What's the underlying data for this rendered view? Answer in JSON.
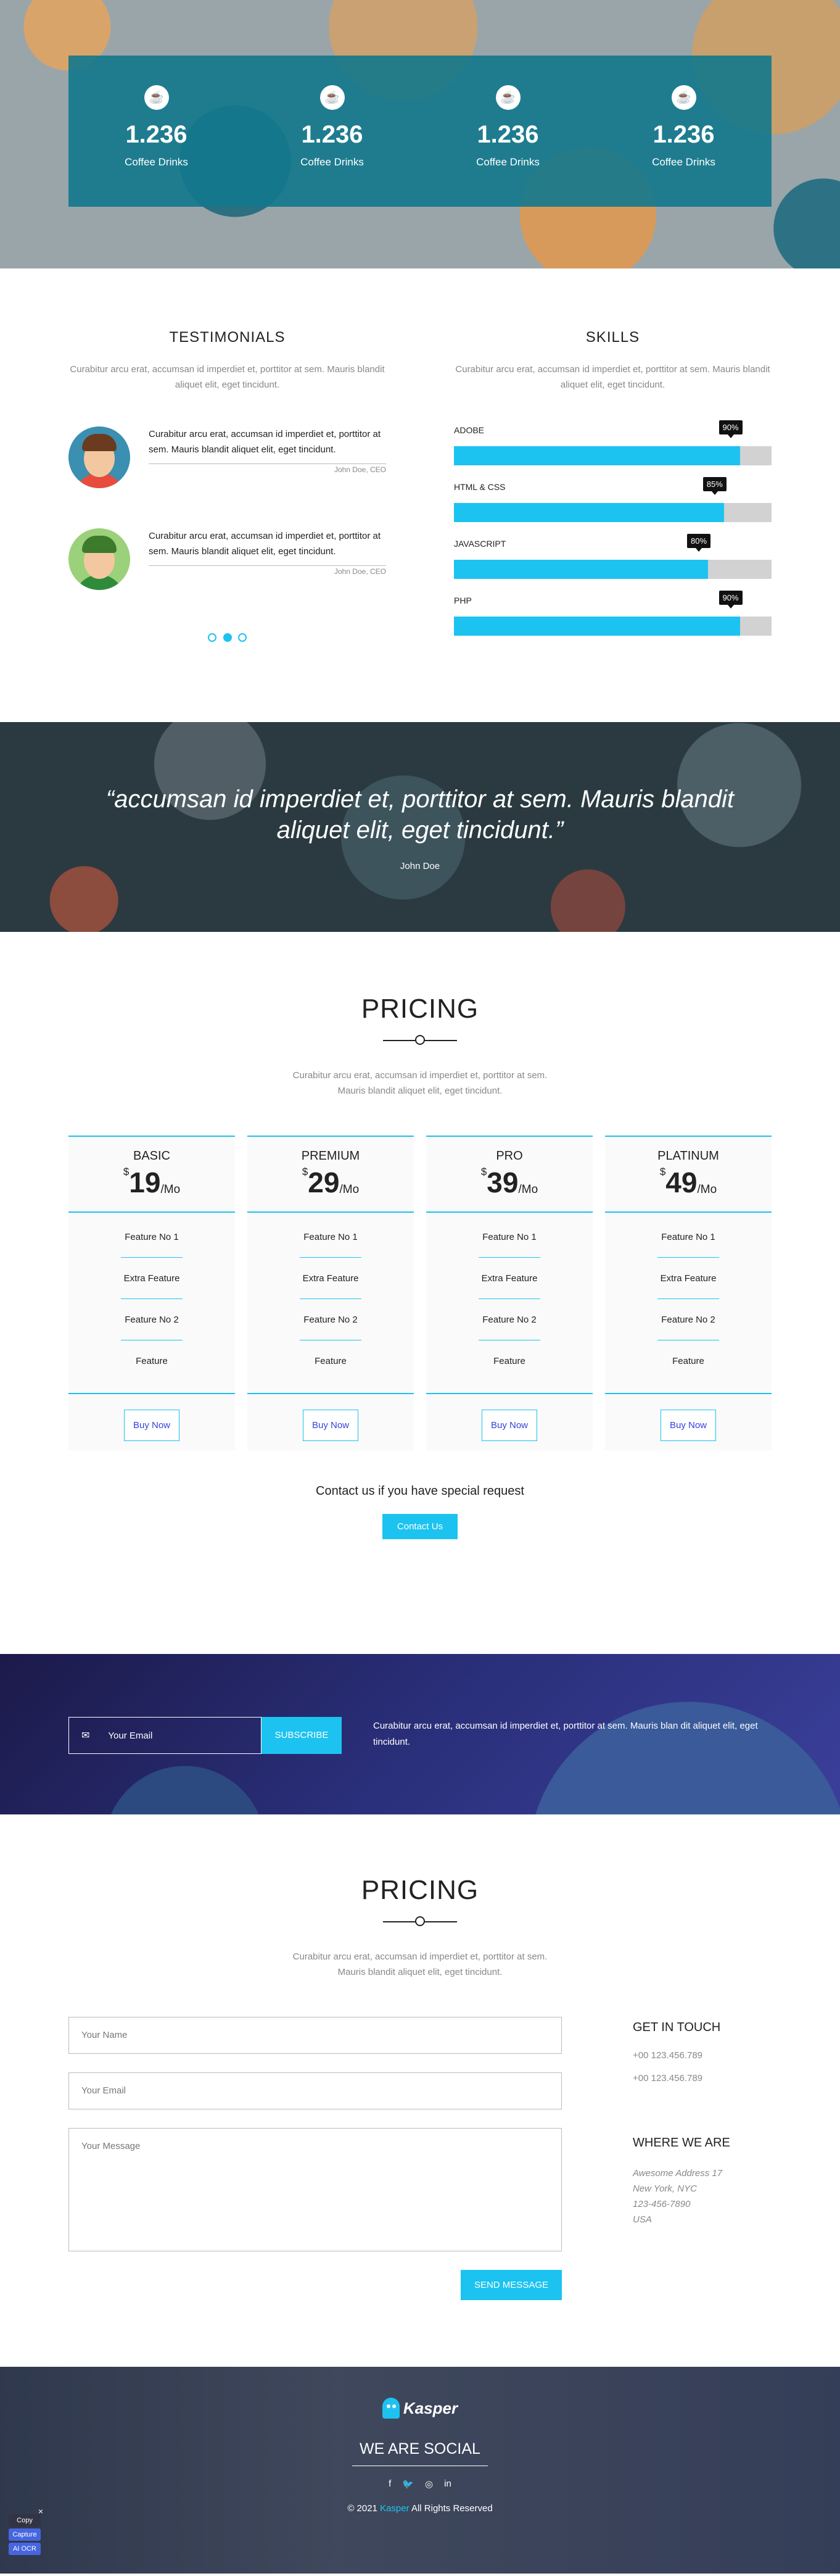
{
  "stats": [
    {
      "icon": "coffee-icon",
      "number": "1.236",
      "label": "Coffee Drinks"
    },
    {
      "icon": "coffee-icon",
      "number": "1.236",
      "label": "Coffee Drinks"
    },
    {
      "icon": "coffee-icon",
      "number": "1.236",
      "label": "Coffee Drinks"
    },
    {
      "icon": "coffee-icon",
      "number": "1.236",
      "label": "Coffee Drinks"
    }
  ],
  "testimonials": {
    "title": "TESTIMONIALS",
    "intro": "Curabitur arcu erat, accumsan id imperdiet et, porttitor at sem. Mauris blandit aliquet elit, eget tincidunt.",
    "items": [
      {
        "text": "Curabitur arcu erat, accumsan id imperdiet et, porttitor at sem. Mauris blandit aliquet elit, eget tincidunt.",
        "author": "John Doe, CEO"
      },
      {
        "text": "Curabitur arcu erat, accumsan id imperdiet et, porttitor at sem. Mauris blandit aliquet elit, eget tincidunt.",
        "author": "John Doe, CEO"
      }
    ]
  },
  "skills": {
    "title": "SKILLS",
    "intro": "Curabitur arcu erat, accumsan id imperdiet et, porttitor at sem. Mauris blandit aliquet elit, eget tincidunt.",
    "items": [
      {
        "name": "ADOBE",
        "value": 90,
        "label": "90%"
      },
      {
        "name": "HTML & CSS",
        "value": 85,
        "label": "85%"
      },
      {
        "name": "JAVASCRIPT",
        "value": 80,
        "label": "80%"
      },
      {
        "name": "PHP",
        "value": 90,
        "label": "90%"
      }
    ]
  },
  "quote": {
    "text": "“accumsan id imperdiet et, porttitor at sem. Mauris blandit aliquet elit, eget tincidunt.”",
    "author": "John Doe"
  },
  "pricing": {
    "title": "PRICING",
    "intro_line1": "Curabitur arcu erat, accumsan id imperdiet et, porttitor at sem.",
    "intro_line2": "Mauris blandit aliquet elit, eget tincidunt.",
    "plans": [
      {
        "name": "BASIC",
        "currency": "$",
        "amount": "19",
        "period": "/Mo",
        "features": [
          "Feature No 1",
          "Extra Feature",
          "Feature No 2",
          "Feature"
        ],
        "button": "Buy Now"
      },
      {
        "name": "PREMIUM",
        "currency": "$",
        "amount": "29",
        "period": "/Mo",
        "features": [
          "Feature No 1",
          "Extra Feature",
          "Feature No 2",
          "Feature"
        ],
        "button": "Buy Now"
      },
      {
        "name": "PRO",
        "currency": "$",
        "amount": "39",
        "period": "/Mo",
        "features": [
          "Feature No 1",
          "Extra Feature",
          "Feature No 2",
          "Feature"
        ],
        "button": "Buy Now"
      },
      {
        "name": "PLATINUM",
        "currency": "$",
        "amount": "49",
        "period": "/Mo",
        "features": [
          "Feature No 1",
          "Extra Feature",
          "Feature No 2",
          "Feature"
        ],
        "button": "Buy Now"
      }
    ],
    "contact_text": "Contact us if you have special request",
    "contact_button": "Contact Us"
  },
  "subscribe": {
    "placeholder": "Your Email",
    "button": "SUBSCRIBE",
    "text": "Curabitur arcu erat, accumsan id imperdiet et, porttitor at sem. Mauris blan dit aliquet elit, eget tincidunt."
  },
  "contact": {
    "title": "PRICING",
    "intro_line1": "Curabitur arcu erat, accumsan id imperdiet et, porttitor at sem.",
    "intro_line2": "Mauris blandit aliquet elit, eget tincidunt.",
    "name_placeholder": "Your Name",
    "email_placeholder": "Your Email",
    "message_placeholder": "Your Message",
    "send_button": "SEND MESSAGE",
    "get_in_touch": "GET IN TOUCH",
    "phones": [
      "+00 123.456.789",
      "+00 123.456.789"
    ],
    "where_we_are": "WHERE WE ARE",
    "address": [
      "Awesome Address 17",
      "New York, NYC",
      "123-456-7890",
      "USA"
    ]
  },
  "footer": {
    "logo_text": "Kasper",
    "social_title": "WE ARE SOCIAL",
    "social_icons": [
      "facebook-icon",
      "twitter-icon",
      "instagram-icon",
      "linkedin-icon"
    ],
    "copy_prefix": "© 2021",
    "copy_brand": "Kasper",
    "copy_suffix": "All Rights Reserved"
  },
  "widget": {
    "buttons": [
      "Copy",
      "Capture",
      "AI OCR"
    ]
  },
  "colors": {
    "accent": "#1cc3f0",
    "stats_box": "#12788c"
  }
}
